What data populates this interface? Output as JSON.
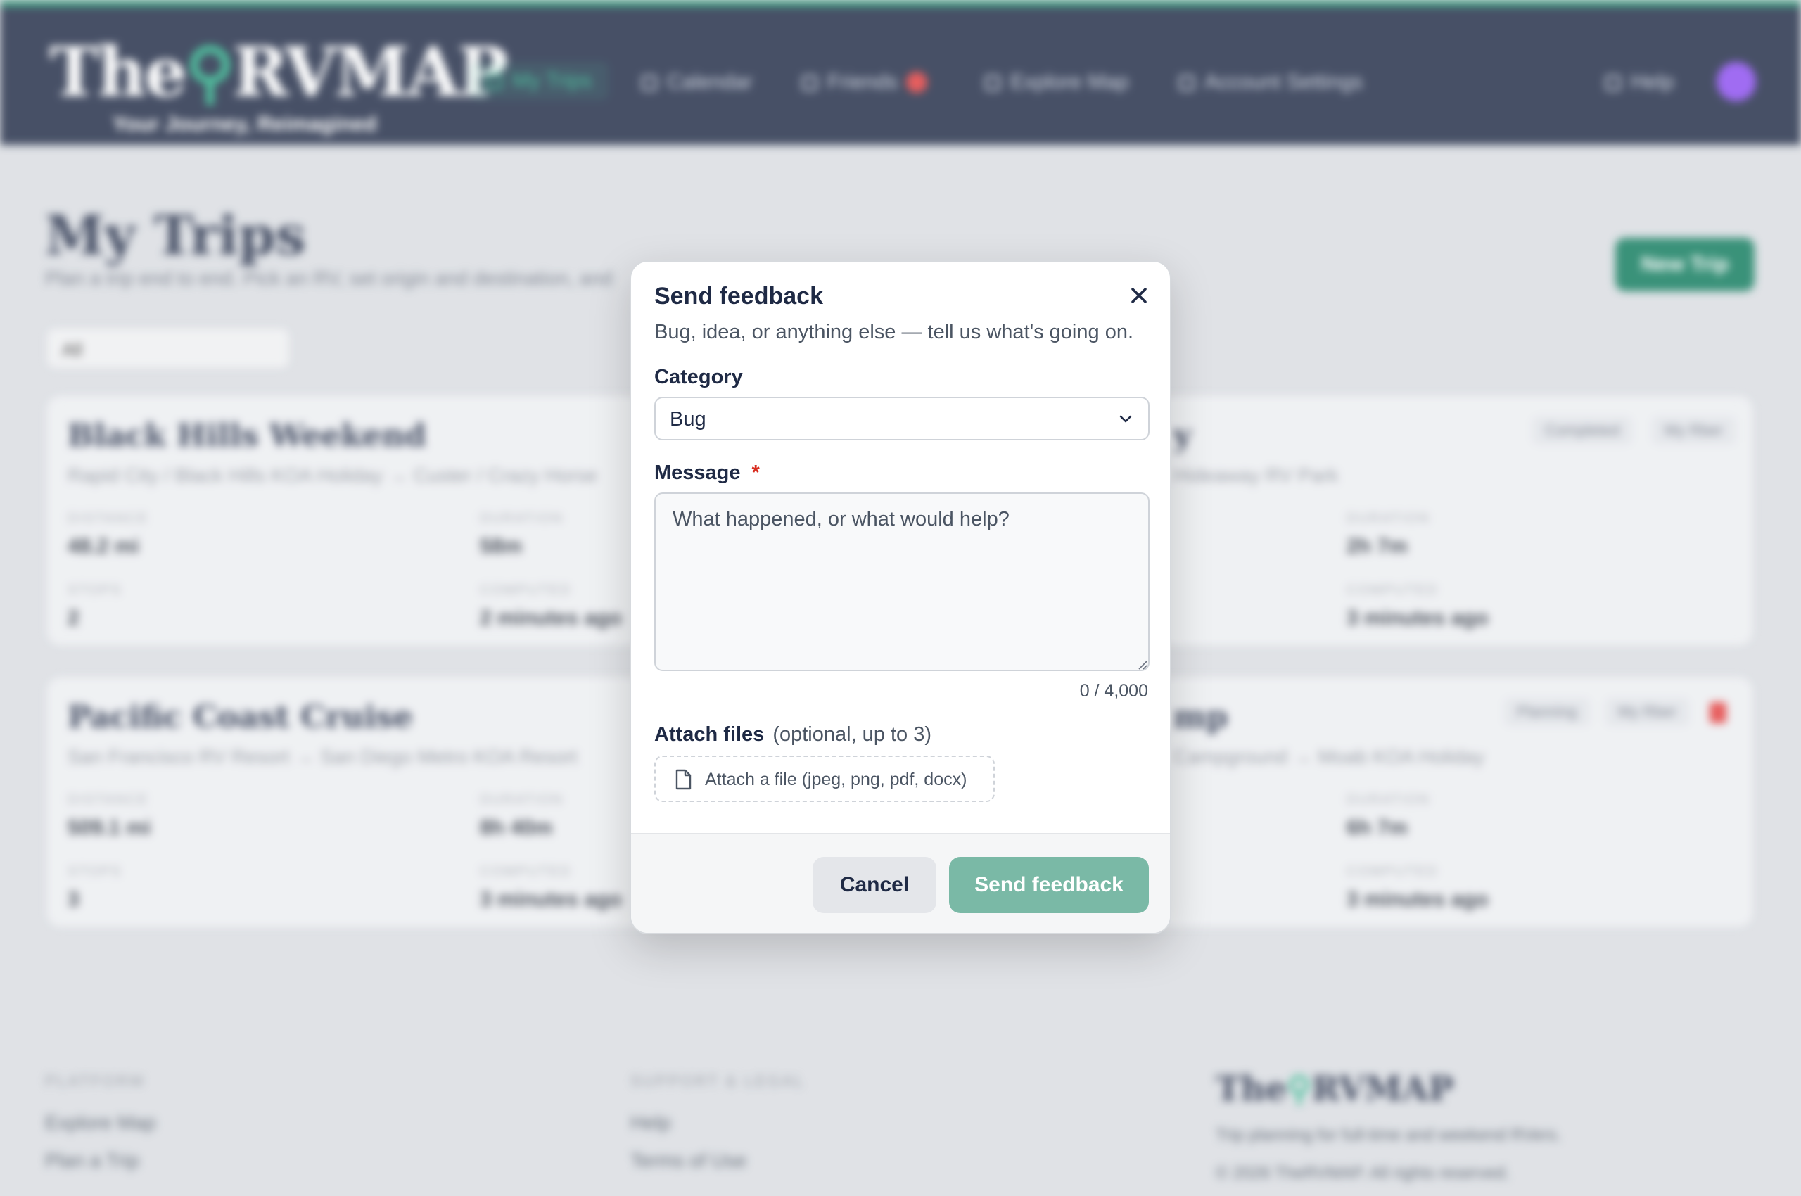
{
  "app": {
    "logo_text_left": "The",
    "logo_text_right": "RVMAP",
    "tagline": "Your Journey, Reimagined"
  },
  "nav": {
    "items": [
      {
        "label": "My Trips",
        "icon": "map-icon"
      },
      {
        "label": "Calendar",
        "icon": "calendar-icon"
      },
      {
        "label": "Friends",
        "icon": "users-icon"
      },
      {
        "label": "Explore Map",
        "icon": "compass-icon"
      },
      {
        "label": "Account Settings",
        "icon": "gear-icon"
      }
    ],
    "help_label": "Help"
  },
  "page": {
    "title": "My Trips",
    "subtitle": "Plan a trip end to end. Pick an RV, set origin and destination, and",
    "new_trip_label": "New Trip",
    "filter_value": "All"
  },
  "trips": [
    {
      "title": "Black Hills Weekend",
      "route": "Rapid City / Black Hills KOA Holiday → Custer / Crazy Horse",
      "stats": {
        "distance_label": "DISTANCE",
        "distance": "48.2 mi",
        "duration_label": "DURATION",
        "duration": "58m",
        "stops_label": "STOPS",
        "stops": "2",
        "computed_label": "COMPUTED",
        "computed": "2 minutes ago"
      }
    },
    {
      "title": "Pacific Coast Cruise",
      "route": "San Francisco RV Resort → San Diego Metro KOA Resort",
      "stats": {
        "distance_label": "DISTANCE",
        "distance": "509.1 mi",
        "duration_label": "DURATION",
        "duration": "8h 40m",
        "stops_label": "STOPS",
        "stops": "3",
        "computed_label": "COMPUTED",
        "computed": "3 minutes ago"
      }
    }
  ],
  "trips_right": [
    {
      "title": "y",
      "route": "Hideaway RV Park",
      "duration_label": "DURATION",
      "duration": "2h 7m",
      "computed_label": "COMPUTED",
      "computed": "3 minutes ago",
      "pills": [
        "Completed",
        "My Rber"
      ]
    },
    {
      "title": "mp",
      "route": "Campground → Moab KOA Holiday",
      "duration_label": "DURATION",
      "duration": "6h 7m",
      "computed_label": "COMPUTED",
      "computed": "3 minutes ago",
      "pills": [
        "Planning",
        "My Rber"
      ]
    }
  ],
  "footer": {
    "col1_heading": "PLATFORM",
    "col1_links": [
      "Explore Map",
      "Plan a Trip"
    ],
    "col2_heading": "SUPPORT & LEGAL",
    "col2_links": [
      "Help",
      "Terms of Use"
    ],
    "brand": "RVMAP",
    "brand_prefix": "The",
    "blurb": "Trip planning for full-time and weekend RVers.",
    "copyright": "© 2026 TheRVMAP. All rights reserved."
  },
  "modal": {
    "title": "Send feedback",
    "subtitle": "Bug, idea, or anything else — tell us what's going on.",
    "category_label": "Category",
    "category_value": "Bug",
    "message_label": "Message",
    "required_mark": "*",
    "message_placeholder": "What happened, or what would help?",
    "message_value": "",
    "counter": "0 / 4,000",
    "attach_label": "Attach files",
    "attach_optional": "(optional, up to 3)",
    "attach_button": "Attach a file (jpeg, png, pdf, docx)",
    "cancel_label": "Cancel",
    "send_label": "Send feedback"
  },
  "colors": {
    "navy": "#1f2a45",
    "accent_green": "#0f7a5c",
    "send_button_disabled": "#7ab9a6",
    "required_red": "#d92d20"
  }
}
